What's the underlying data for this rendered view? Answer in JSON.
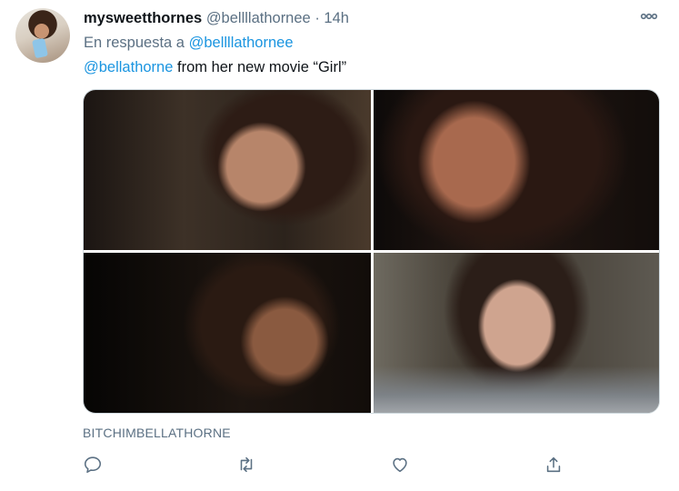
{
  "tweet": {
    "display_name": "mysweetthornes",
    "handle": "@bellllathornee",
    "separator": "·",
    "time": "14h",
    "reply_prefix": "En respuesta a",
    "reply_to": "@bellllathornee",
    "mention": "@bellathorne",
    "body_text": " from her new movie “Girl”",
    "source_label": "BITCHIMBELLATHORNE"
  },
  "icons": {
    "more": "more-horizontal-icon",
    "reply": "reply-icon",
    "retweet": "retweet-icon",
    "like": "heart-icon",
    "share": "share-icon"
  },
  "colors": {
    "link": "#1b95e0",
    "muted": "#5b7083",
    "text": "#0f1419"
  }
}
